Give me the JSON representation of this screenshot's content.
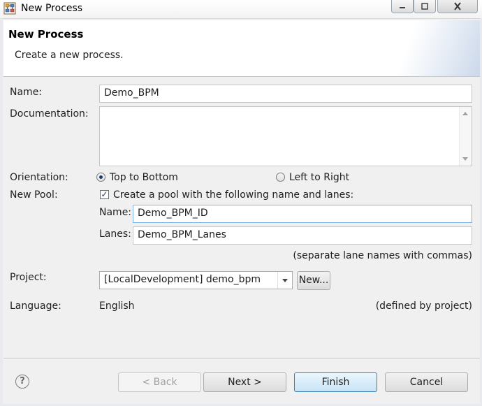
{
  "window": {
    "title": "New Process",
    "icons": {
      "app": "process-app-icon",
      "minimize": "minimize-icon",
      "maximize": "maximize-icon",
      "close": "close-icon"
    }
  },
  "header": {
    "title": "New Process",
    "description": "Create a new process."
  },
  "form": {
    "name_label": "Name:",
    "name_value": "Demo_BPM",
    "documentation_label": "Documentation:",
    "documentation_value": "",
    "orientation_label": "Orientation:",
    "orientation_options": [
      "Top to Bottom",
      "Left to Right"
    ],
    "orientation_selected": "Top to Bottom",
    "new_pool_label": "New Pool:",
    "new_pool_checkbox_label": "Create a pool with the following name and lanes:",
    "new_pool_checked": true,
    "pool_name_label": "Name:",
    "pool_name_value": "Demo_BPM_ID",
    "lanes_label": "Lanes:",
    "lanes_value": "Demo_BPM_Lanes",
    "lanes_hint": "(separate lane names with commas)",
    "project_label": "Project:",
    "project_value": "[LocalDevelopment] demo_bpm",
    "project_new_button": "New...",
    "language_label": "Language:",
    "language_value": "English",
    "language_note": "(defined by project)"
  },
  "footer": {
    "back": "< Back",
    "next": "Next >",
    "finish": "Finish",
    "cancel": "Cancel",
    "help_icon": "help-icon",
    "help_glyph": "?"
  },
  "colors": {
    "default_button_border": "#3c7fb1",
    "focus_border": "#7eb4ea",
    "background": "#f0f0f0"
  }
}
